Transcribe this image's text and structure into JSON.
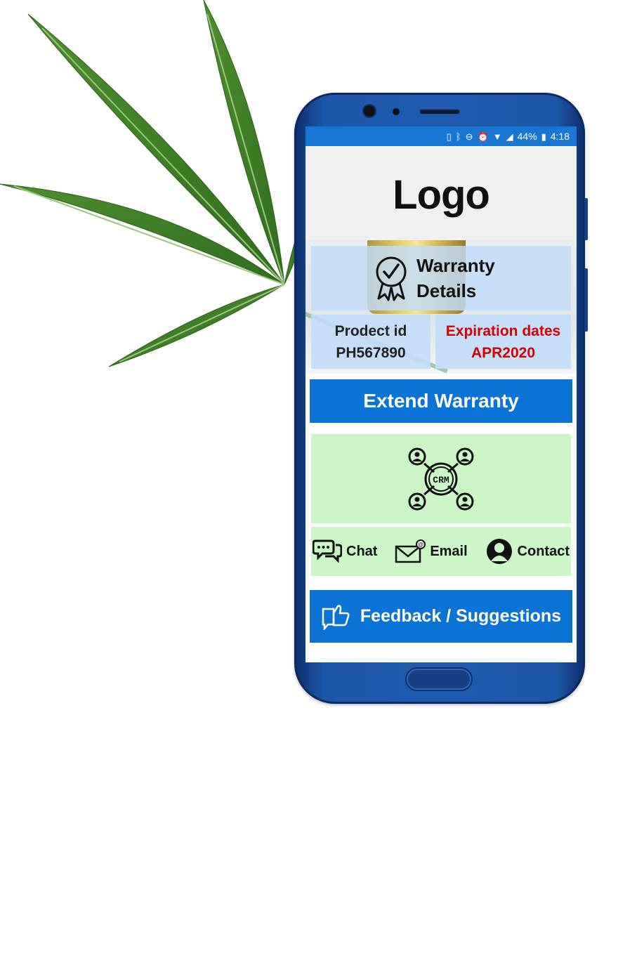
{
  "status_bar": {
    "battery": "44%",
    "time": "4:18",
    "icons": [
      "phone-icon",
      "bluetooth-icon",
      "do-not-disturb-icon",
      "alarm-icon",
      "wifi-icon",
      "signal-icon",
      "battery-icon"
    ]
  },
  "header": {
    "logo_text": "Logo"
  },
  "warranty": {
    "title_line1": "Warranty",
    "title_line2": "Details",
    "icon": "award-ribbon-icon"
  },
  "product": {
    "id_label": "Prodect id",
    "id_value": "PH567890"
  },
  "expiration": {
    "label": "Expiration dates",
    "value": "APR2020"
  },
  "actions": {
    "extend_label": "Extend Warranty",
    "feedback_label": "Feedback / Suggestions"
  },
  "crm": {
    "icon_text": "CRM",
    "icon": "crm-network-icon"
  },
  "contact_options": {
    "chat": "Chat",
    "email": "Email",
    "contact": "Contact"
  },
  "colors": {
    "primary": "#0a73d5",
    "status_bar": "#1976d2",
    "panel_blue": "#c2dcfa",
    "panel_green": "#ccf5c8",
    "alert_red": "#d50000"
  }
}
